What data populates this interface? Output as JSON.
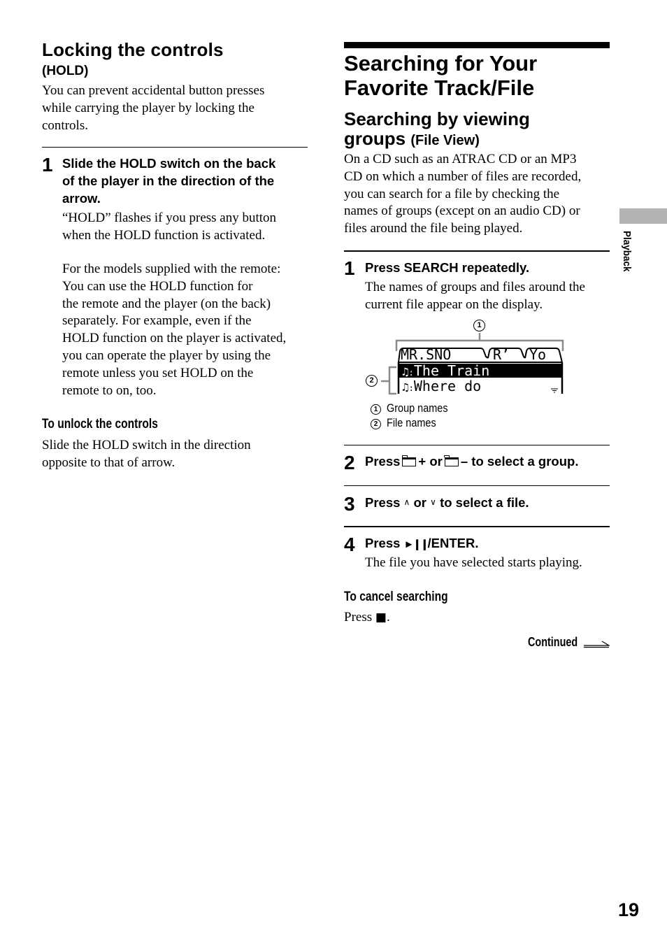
{
  "left": {
    "title": "Locking the controls",
    "title_sub": "(HOLD)",
    "intro_lines": [
      "You can prevent accidental button presses",
      "while carrying the player by locking the",
      "controls."
    ],
    "step1": {
      "number": "1",
      "title_lines": [
        "Slide the HOLD switch on the back",
        "of the player in the direction of the",
        "arrow."
      ],
      "body_lines": [
        "“HOLD” flashes if you press any button",
        "when the HOLD function is activated."
      ],
      "note_lines": [
        "For the models supplied with the remote:",
        "You can use the HOLD function for",
        "the remote and the player (on the back)",
        "separately.  For example, even if the",
        "HOLD function on the player is activated,",
        "you can operate the player by using the",
        "remote unless you set HOLD on the",
        "remote to on, too."
      ]
    },
    "unlock": {
      "heading": "To unlock the controls",
      "lines": [
        "Slide the HOLD switch in the direction",
        "opposite to that of arrow."
      ]
    }
  },
  "right": {
    "title_lines": [
      "Searching for Your",
      "Favorite Track/File"
    ],
    "subtitle_main_1": "Searching by viewing",
    "subtitle_main_2": "groups",
    "subtitle_sub": "(File View)",
    "intro_lines": [
      "On a CD such as an ATRAC CD or an MP3",
      "CD on which a number of files are recorded,",
      "you can search for a file by checking the",
      "names of groups (except on an audio CD) or",
      "files around the file being played."
    ],
    "step1": {
      "number": "1",
      "title": "Press SEARCH repeatedly.",
      "body_lines": [
        "The names of groups and files around the",
        "current file appear on the display."
      ]
    },
    "display": {
      "callout_1": "1",
      "callout_2": "2",
      "group_tabs": [
        "MR.SNO",
        "R’",
        "Yo"
      ],
      "files": [
        {
          "name": "The Train",
          "selected": true
        },
        {
          "name": "Where do",
          "selected": false
        }
      ],
      "note_icon": "♫",
      "legend": [
        {
          "num": "1",
          "label": "Group names"
        },
        {
          "num": "2",
          "label": "File names"
        }
      ]
    },
    "step2": {
      "number": "2",
      "press": "Press",
      "plus": "+ or",
      "minus": "– to select a group."
    },
    "step3": {
      "number": "3",
      "text_1": "Press",
      "up": "∧",
      "or": "or",
      "down": "∨",
      "text_2": "to select a file."
    },
    "step4": {
      "number": "4",
      "press": "Press",
      "play_pause": "►❙❙",
      "enter": "/ENTER.",
      "body": "The file you have selected starts playing."
    },
    "cancel": {
      "heading": "To cancel searching",
      "press": "Press",
      "stop_symbol": "■",
      "period": "."
    },
    "continued": "Continued"
  },
  "side_tab": {
    "label": "Playback",
    "color": "#b3b3b3"
  },
  "page_number": "19"
}
